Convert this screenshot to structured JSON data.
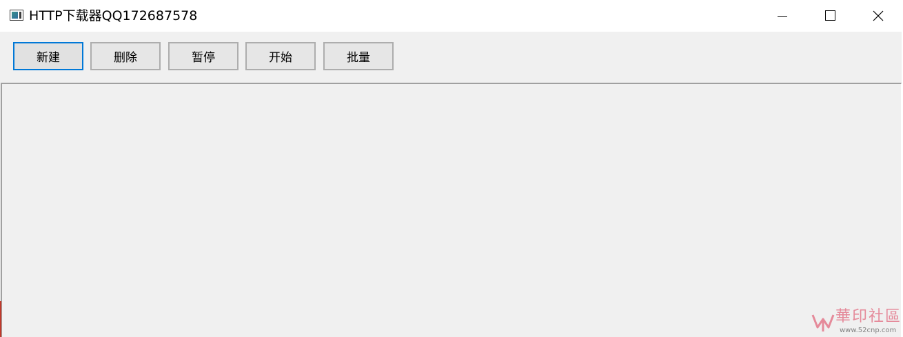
{
  "window": {
    "title": "HTTP下载器QQ172687578",
    "controls": {
      "minimize_icon": "minimize-icon",
      "maximize_icon": "maximize-icon",
      "close_icon": "close-icon"
    }
  },
  "toolbar": {
    "buttons": [
      {
        "label": "新建",
        "focused": true
      },
      {
        "label": "删除",
        "focused": false
      },
      {
        "label": "暂停",
        "focused": false
      },
      {
        "label": "开始",
        "focused": false
      },
      {
        "label": "批量",
        "focused": false
      }
    ]
  },
  "watermark": {
    "text": "華印社區",
    "url": "www.52cnp.com"
  },
  "colors": {
    "focus_border": "#0078d7",
    "window_bg": "#f0f0f0",
    "watermark": "#e58a9a"
  }
}
